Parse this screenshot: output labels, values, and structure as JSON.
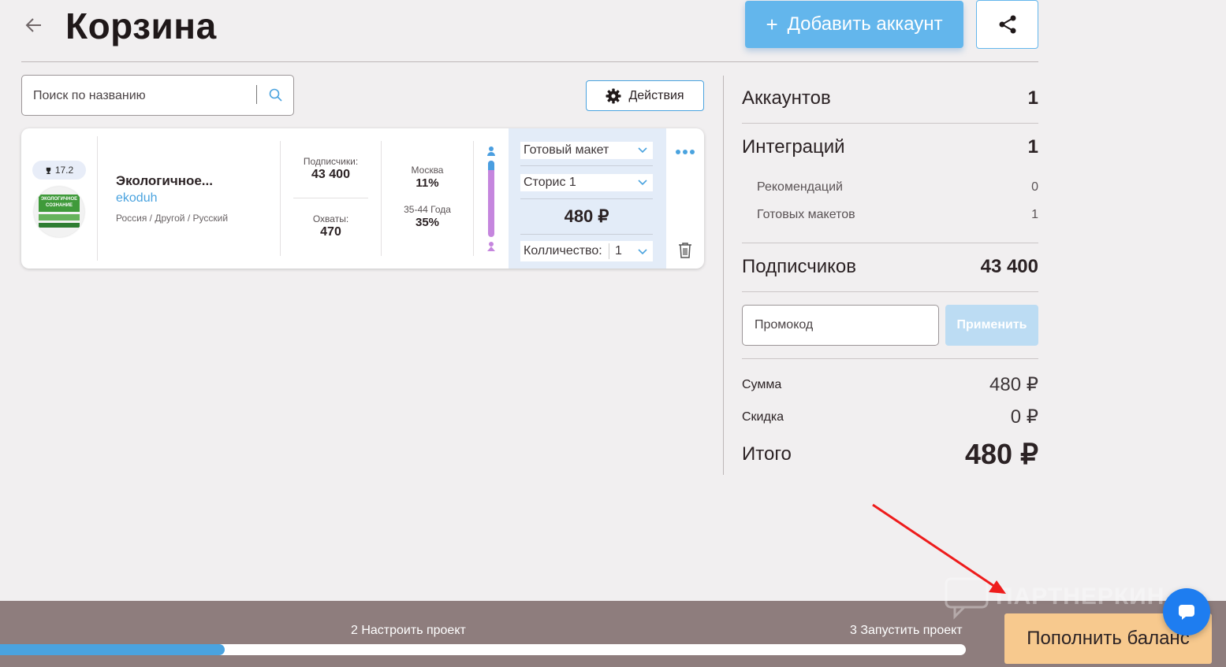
{
  "header": {
    "back_icon": "arrow-left-icon",
    "title": "Корзина",
    "add_account_plus": "+",
    "add_account_label": "Добавить аккаунт",
    "share_icon": "share-icon"
  },
  "toolbar": {
    "search_placeholder": "Поиск по названию",
    "search_icon": "search-icon",
    "actions_label": "Действия",
    "actions_icon": "gear-icon"
  },
  "cart_item": {
    "rating": "17.2",
    "rating_icon": "trophy-icon",
    "avatar_text_top": "ЭКОЛОГИЧНОЕ",
    "avatar_text_bottom": "СОЗНАНИЕ",
    "name": "Экологичное...",
    "login": "ekoduh",
    "geo": "Россия / Другой / Русский",
    "subscribers_label": "Подписчики:",
    "subscribers_value": "43 400",
    "reach_label": "Охваты:",
    "reach_value": "470",
    "city_label": "Москва",
    "city_value": "11%",
    "age_label": "35-44 Года",
    "age_value": "35%",
    "gender_male_share": 0.12,
    "format_select": "Готовый макет",
    "type_select": "Сторис 1",
    "price": "480 ₽",
    "quantity_label": "Колличество:",
    "quantity_value": "1",
    "more_icon": "more-icon",
    "delete_icon": "trash-icon"
  },
  "summary": {
    "accounts_label": "Аккаунтов",
    "accounts_value": "1",
    "integrations_label": "Интеграций",
    "integrations_value": "1",
    "recommendations_label": "Рекомендаций",
    "recommendations_value": "0",
    "ready_layouts_label": "Готовых макетов",
    "ready_layouts_value": "1",
    "subscribers_label": "Подписчиков",
    "subscribers_value": "43 400",
    "promo_placeholder": "Промокод",
    "apply_label": "Применить",
    "sum_label": "Сумма",
    "sum_value": "480 ₽",
    "discount_label": "Скидка",
    "discount_value": "0 ₽",
    "total_label": "Итого",
    "total_value": "480 ₽"
  },
  "footer": {
    "step2_label": "2 Настроить проект",
    "step3_label": "3 Запустить проект",
    "progress": 0.233,
    "topup_label": "Пополнить баланс",
    "watermark": "ПАРТНЕРКИН",
    "chat_icon": "chat-icon"
  },
  "colors": {
    "accent": "#4aa3df",
    "add_button": "#63b6ec",
    "footer": "#8e7d7d",
    "topup": "#f7c98e",
    "chat": "#1e7df0",
    "annotation_arrow": "#ee1c1c"
  }
}
